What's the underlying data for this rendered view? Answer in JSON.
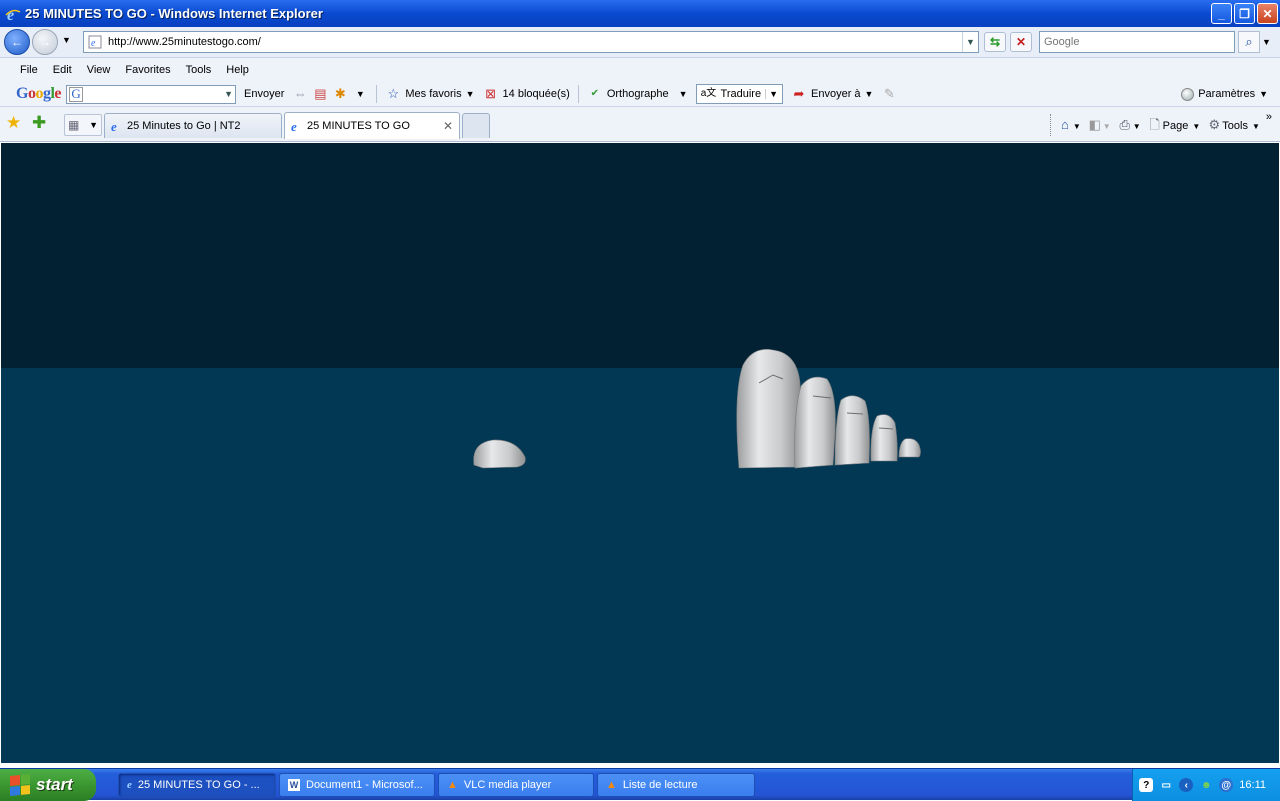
{
  "window": {
    "title": "25 MINUTES TO GO - Windows Internet Explorer",
    "minimize_label": "_",
    "maximize_label": "❐",
    "close_label": "✕"
  },
  "address_bar": {
    "url": "http://www.25minutestogo.com/",
    "search_placeholder": "Google"
  },
  "menu": [
    "File",
    "Edit",
    "View",
    "Favorites",
    "Tools",
    "Help"
  ],
  "google_toolbar": {
    "logo": "Google",
    "search_glyph": "G",
    "send_label": "Envoyer",
    "favorites_label": "Mes favoris",
    "blocked_label": "14 bloquée(s)",
    "spelling_label": "Orthographe",
    "translate_label": "Traduire",
    "send_to_label": "Envoyer à",
    "settings_label": "Paramètres"
  },
  "tabs": [
    {
      "label": "25 Minutes to Go | NT2",
      "active": false
    },
    {
      "label": "25 MINUTES TO GO",
      "active": true
    }
  ],
  "right_tools": {
    "page_label": "Page",
    "tools_label": "Tools"
  },
  "page": {
    "sky_color": "#022234",
    "sea_color": "#033854",
    "rock_color": "#d8dadc"
  },
  "taskbar": {
    "start_label": "start",
    "items": [
      {
        "label": "25 MINUTES TO GO - ...",
        "icon": "ie-icon",
        "active": true
      },
      {
        "label": "Document1 - Microsof...",
        "icon": "word-icon",
        "active": false
      },
      {
        "label": "VLC media player",
        "icon": "vlc-icon",
        "active": false
      },
      {
        "label": "Liste de lecture",
        "icon": "vlc-icon",
        "active": false
      }
    ],
    "clock": "16:11"
  }
}
